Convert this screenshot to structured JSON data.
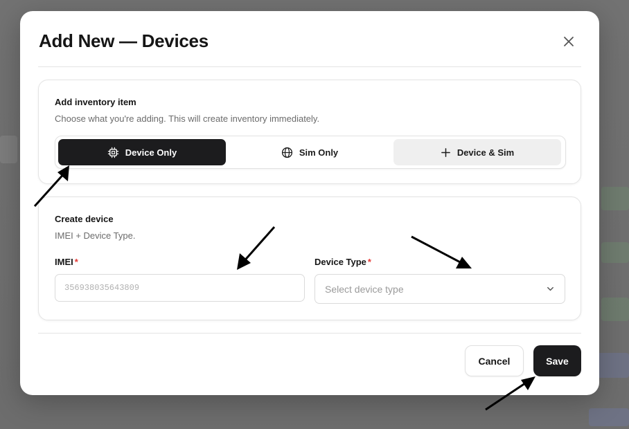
{
  "modal": {
    "title": "Add New — Devices",
    "close_icon": "close-icon"
  },
  "inventory_card": {
    "heading": "Add inventory item",
    "subtitle": "Choose what you're adding. This will create inventory immediately.",
    "options": [
      {
        "label": "Device Only",
        "icon": "chip-icon",
        "state": "selected"
      },
      {
        "label": "Sim Only",
        "icon": "globe-icon",
        "state": "default"
      },
      {
        "label": "Device & Sim",
        "icon": "plus-icon",
        "state": "hover"
      }
    ]
  },
  "device_card": {
    "heading": "Create device",
    "subtitle": "IMEI + Device Type.",
    "imei": {
      "label": "IMEI",
      "required_mark": "*",
      "placeholder": "356938035643809",
      "value": ""
    },
    "device_type": {
      "label": "Device Type",
      "required_mark": "*",
      "placeholder": "Select device type",
      "icon": "chevron-down-icon"
    }
  },
  "footer": {
    "cancel_label": "Cancel",
    "save_label": "Save"
  },
  "colors": {
    "primary_dark": "#1c1c1e",
    "required_red": "#e53935",
    "muted_bg": "#efefef"
  }
}
